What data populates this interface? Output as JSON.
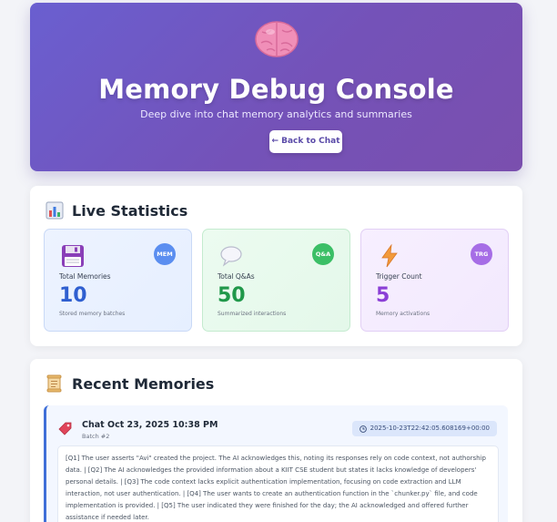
{
  "hero": {
    "icon": "brain-icon",
    "title": "Memory Debug Console",
    "subtitle": "Deep dive into chat memory analytics and summaries",
    "back_button": "← Back to Chat"
  },
  "stats": {
    "section_icon": "bar-chart-icon",
    "section_title": "Live Statistics",
    "items": [
      {
        "icon": "floppy-disk-icon",
        "badge": "MEM",
        "label": "Total Memories",
        "value": "10",
        "caption": "Stored memory batches",
        "accent": "#2f5fd0"
      },
      {
        "icon": "speech-bubble-icon",
        "badge": "Q&A",
        "label": "Total Q&As",
        "value": "50",
        "caption": "Summarized interactions",
        "accent": "#20984a"
      },
      {
        "icon": "lightning-icon",
        "badge": "TRG",
        "label": "Trigger Count",
        "value": "5",
        "caption": "Memory activations",
        "accent": "#8b3fd6"
      }
    ]
  },
  "memories": {
    "section_icon": "scroll-icon",
    "section_title": "Recent Memories",
    "entries": [
      {
        "icon": "tag-icon",
        "title": "Chat Oct 23, 2025 10:38 PM",
        "batch": "Batch #2",
        "timestamp": "2025-10-23T22:42:05.608169+00:00",
        "summary": "[Q1] The user asserts \"Avi\" created the project. The AI acknowledges this, noting its responses rely on code context, not authorship data. | [Q2] The AI acknowledges the provided information about a KIIT CSE student but states it lacks knowledge of developers' personal details. | [Q3] The code context lacks explicit authentication implementation, focusing on code extraction and LLM interaction, not user authentication. | [Q4] The user wants to create an authentication function in the `chunker.py` file, and code implementation is provided. | [Q5] The user indicated they were finished for the day; the AI acknowledged and offered further assistance if needed later."
      }
    ]
  }
}
